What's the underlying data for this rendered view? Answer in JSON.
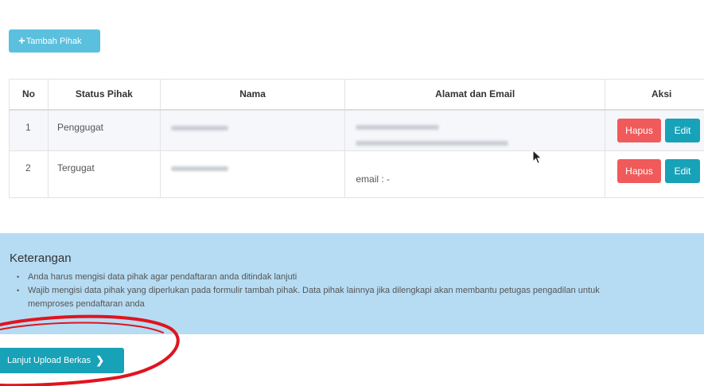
{
  "toolbar": {
    "add_plus": "+",
    "add_label": "Tambah Pihak"
  },
  "table": {
    "headers": {
      "no": "No",
      "status": "Status Pihak",
      "nama": "Nama",
      "alamat": "Alamat dan Email",
      "aksi": "Aksi"
    },
    "rows": [
      {
        "no": "1",
        "status": "Penggugat",
        "email_text": ""
      },
      {
        "no": "2",
        "status": "Tergugat",
        "email_text": "email : -"
      }
    ],
    "delete_label": "Hapus",
    "edit_label": "Edit"
  },
  "info": {
    "title": "Keterangan",
    "item_1": "Anda harus mengisi data pihak agar pendaftaran anda ditindak lanjuti",
    "item_2_line_1": "Wajib mengisi data pihak yang diperlukan pada formulir tambah pihak. Data pihak lainnya jika dilengkapi akan membantu petugas pengadilan untuk",
    "item_2_line_2": "memproses pendaftaran anda"
  },
  "footer": {
    "next_label": "Lanjut Upload Berkas",
    "next_chevron": "❯"
  },
  "colors": {
    "info_button": "#5bc0de",
    "danger": "#f05a5a",
    "teal": "#17a2b8",
    "panel": "#b6dcf3",
    "annotation": "#e0141e"
  }
}
